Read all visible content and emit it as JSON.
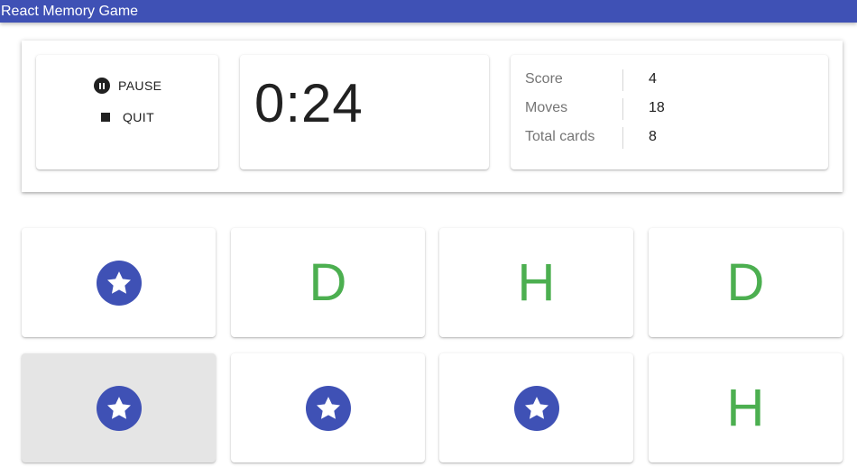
{
  "app": {
    "title": "React Memory Game"
  },
  "theme": {
    "brand": "#3f51b5",
    "green": "#4caf50"
  },
  "controls": {
    "pause_label": "PAUSE",
    "quit_label": "QUIT",
    "pause_icon": "pause-circle-icon",
    "quit_icon": "stop-icon"
  },
  "timer": {
    "value": "0:24"
  },
  "stats": [
    {
      "label": "Score",
      "value": "4"
    },
    {
      "label": "Moves",
      "value": "18"
    },
    {
      "label": "Total cards",
      "value": "8"
    }
  ],
  "cards": [
    {
      "face": "star",
      "letter": ""
    },
    {
      "face": "letter",
      "letter": "D"
    },
    {
      "face": "letter",
      "letter": "H"
    },
    {
      "face": "letter",
      "letter": "D"
    },
    {
      "face": "star",
      "letter": "",
      "selected": true
    },
    {
      "face": "star",
      "letter": ""
    },
    {
      "face": "star",
      "letter": ""
    },
    {
      "face": "letter",
      "letter": "H"
    }
  ]
}
